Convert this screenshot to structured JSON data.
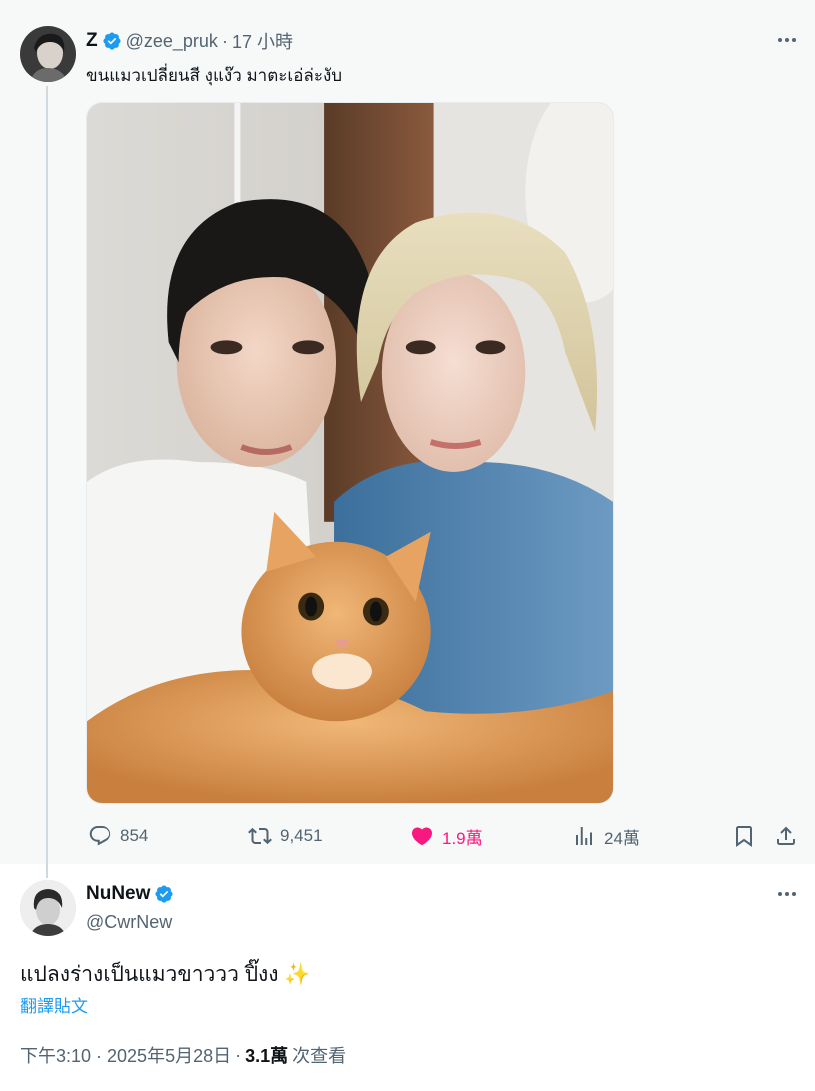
{
  "parent_tweet": {
    "author": {
      "display_name": "Z",
      "handle": "@zee_pruk",
      "verified": true
    },
    "separator": "·",
    "time_ago": "17 小時",
    "text": "ขนแมวเปลี่ยนสี งุแง๊ว มาตะเอ่ล่ะงับ",
    "media": {
      "type": "photo"
    },
    "actions": {
      "replies": "854",
      "retweets": "9,451",
      "likes": "1.9萬",
      "views": "24萬"
    },
    "icons": {
      "reply": "reply-icon",
      "retweet": "retweet-icon",
      "like": "heart-icon",
      "views": "views-icon",
      "bookmark": "bookmark-icon",
      "share": "share-icon",
      "more": "more-icon"
    }
  },
  "main_tweet": {
    "author": {
      "display_name": "NuNew",
      "handle": "@CwrNew",
      "verified": true
    },
    "text": "แปลงร่างเป็นแมวขาววว ปิ๊งง ✨",
    "translate_label": "翻譯貼文",
    "timestamp": "下午3:10 · 2025年5月28日",
    "separator": "·",
    "views_count": "3.1萬",
    "views_label": "次查看"
  },
  "colors": {
    "accent_blue": "#1d9bf0",
    "like_pink": "#f91880",
    "secondary_text": "#536471",
    "parent_bg": "#f7f9f9"
  }
}
